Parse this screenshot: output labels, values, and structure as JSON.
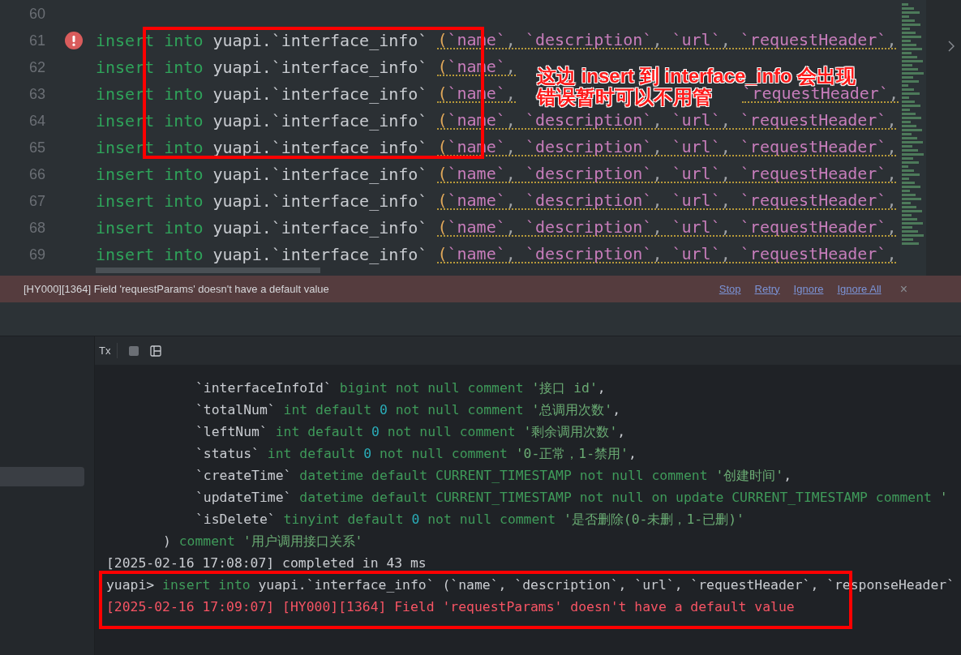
{
  "editor": {
    "lines": [
      {
        "number": "60",
        "error": false
      },
      {
        "number": "61",
        "error": true,
        "warning": true,
        "tokens": [
          {
            "kind": "keyword",
            "text": "insert into "
          },
          {
            "kind": "plain",
            "text": "yuapi.`interface_info` "
          },
          {
            "kind": "paren",
            "text": "("
          },
          {
            "kind": "column",
            "text": "`name`"
          },
          {
            "kind": "punct",
            "text": ", "
          },
          {
            "kind": "column",
            "text": "`description`"
          },
          {
            "kind": "punct",
            "text": ", "
          },
          {
            "kind": "column",
            "text": "`url`"
          },
          {
            "kind": "punct",
            "text": ", "
          },
          {
            "kind": "column",
            "text": "`requestHeader`"
          },
          {
            "kind": "punct",
            "text": ","
          }
        ]
      },
      {
        "number": "62",
        "error": false,
        "warning": true,
        "tokens": [
          {
            "kind": "keyword",
            "text": "insert into "
          },
          {
            "kind": "plain",
            "text": "yuapi.`interface_info` "
          },
          {
            "kind": "paren",
            "text": "("
          },
          {
            "kind": "column",
            "text": "`name`"
          },
          {
            "kind": "punct",
            "text": ","
          }
        ]
      },
      {
        "number": "63",
        "error": false,
        "warning": true,
        "tokens": [
          {
            "kind": "keyword",
            "text": "insert into "
          },
          {
            "kind": "plain",
            "text": "yuapi.`interface_info` "
          },
          {
            "kind": "paren",
            "text": "("
          },
          {
            "kind": "column",
            "text": "`name`"
          },
          {
            "kind": "punct",
            "text": ","
          }
        ],
        "tail_tokens": [
          {
            "kind": "column",
            "text": "`requestHeader`"
          },
          {
            "kind": "punct",
            "text": ","
          }
        ]
      },
      {
        "number": "64",
        "error": false,
        "warning": true,
        "tokens": [
          {
            "kind": "keyword",
            "text": "insert into "
          },
          {
            "kind": "plain",
            "text": "yuapi.`interface_info` "
          },
          {
            "kind": "paren",
            "text": "("
          },
          {
            "kind": "column",
            "text": "`name`"
          },
          {
            "kind": "punct",
            "text": ", "
          },
          {
            "kind": "column",
            "text": "`description`"
          },
          {
            "kind": "punct",
            "text": ", "
          },
          {
            "kind": "column",
            "text": "`url`"
          },
          {
            "kind": "punct",
            "text": ", "
          },
          {
            "kind": "column",
            "text": "`requestHeader`"
          },
          {
            "kind": "punct",
            "text": ","
          }
        ]
      },
      {
        "number": "65",
        "error": false,
        "warning": true,
        "tokens": [
          {
            "kind": "keyword",
            "text": "insert into "
          },
          {
            "kind": "plain",
            "text": "yuapi.`interface_info` "
          },
          {
            "kind": "paren",
            "text": "("
          },
          {
            "kind": "column",
            "text": "`name`"
          },
          {
            "kind": "punct",
            "text": ", "
          },
          {
            "kind": "column",
            "text": "`description`"
          },
          {
            "kind": "punct",
            "text": ", "
          },
          {
            "kind": "column",
            "text": "`url`"
          },
          {
            "kind": "punct",
            "text": ", "
          },
          {
            "kind": "column",
            "text": "`requestHeader`"
          },
          {
            "kind": "punct",
            "text": ","
          }
        ]
      },
      {
        "number": "66",
        "error": false,
        "warning": true,
        "tokens": [
          {
            "kind": "keyword",
            "text": "insert into "
          },
          {
            "kind": "plain",
            "text": "yuapi.`interface_info` "
          },
          {
            "kind": "paren",
            "text": "("
          },
          {
            "kind": "column",
            "text": "`name`"
          },
          {
            "kind": "punct",
            "text": ", "
          },
          {
            "kind": "column",
            "text": "`description`"
          },
          {
            "kind": "punct",
            "text": ", "
          },
          {
            "kind": "column",
            "text": "`url`"
          },
          {
            "kind": "punct",
            "text": ", "
          },
          {
            "kind": "column",
            "text": "`requestHeader`"
          },
          {
            "kind": "punct",
            "text": ","
          }
        ]
      },
      {
        "number": "67",
        "error": false,
        "warning": true,
        "tokens": [
          {
            "kind": "keyword",
            "text": "insert into "
          },
          {
            "kind": "plain",
            "text": "yuapi.`interface_info` "
          },
          {
            "kind": "paren",
            "text": "("
          },
          {
            "kind": "column",
            "text": "`name`"
          },
          {
            "kind": "punct",
            "text": ", "
          },
          {
            "kind": "column",
            "text": "`description`"
          },
          {
            "kind": "punct",
            "text": ", "
          },
          {
            "kind": "column",
            "text": "`url`"
          },
          {
            "kind": "punct",
            "text": ", "
          },
          {
            "kind": "column",
            "text": "`requestHeader`"
          },
          {
            "kind": "punct",
            "text": ","
          }
        ]
      },
      {
        "number": "68",
        "error": false,
        "warning": true,
        "tokens": [
          {
            "kind": "keyword",
            "text": "insert into "
          },
          {
            "kind": "plain",
            "text": "yuapi.`interface_info` "
          },
          {
            "kind": "paren",
            "text": "("
          },
          {
            "kind": "column",
            "text": "`name`"
          },
          {
            "kind": "punct",
            "text": ", "
          },
          {
            "kind": "column",
            "text": "`description`"
          },
          {
            "kind": "punct",
            "text": ", "
          },
          {
            "kind": "column",
            "text": "`url`"
          },
          {
            "kind": "punct",
            "text": ", "
          },
          {
            "kind": "column",
            "text": "`requestHeader`"
          },
          {
            "kind": "punct",
            "text": ","
          }
        ]
      },
      {
        "number": "69",
        "error": false,
        "warning": true,
        "tokens": [
          {
            "kind": "keyword",
            "text": "insert into "
          },
          {
            "kind": "plain",
            "text": "yuapi.`interface_info` "
          },
          {
            "kind": "paren",
            "text": "("
          },
          {
            "kind": "column",
            "text": "`name`"
          },
          {
            "kind": "punct",
            "text": ", "
          },
          {
            "kind": "column",
            "text": "`description`"
          },
          {
            "kind": "punct",
            "text": ", "
          },
          {
            "kind": "column",
            "text": "`url`"
          },
          {
            "kind": "punct",
            "text": ", "
          },
          {
            "kind": "column",
            "text": "`requestHeader`"
          },
          {
            "kind": "punct",
            "text": ","
          }
        ]
      }
    ],
    "error_bar": {
      "message": "[HY000][1364] Field 'requestParams' doesn't have a default value",
      "actions": [
        "Stop",
        "Retry",
        "Ignore",
        "Ignore All"
      ],
      "close": "×"
    },
    "annotation": [
      "这边 insert 到 interface_info 会出现",
      "错误暂时可以不用管"
    ]
  },
  "console": {
    "toolbar": {
      "tx": "Tx"
    },
    "sidebar": {
      "items": [
        {
          "selected": true
        }
      ]
    },
    "lines": [
      {
        "kind": "column",
        "tokens": [
          {
            "kind": "field",
            "text": "`interfaceInfoId` "
          },
          {
            "kind": "keyword",
            "text": "bigint not null comment "
          },
          {
            "kind": "string",
            "text": "'接口 id'"
          },
          {
            "kind": "plain",
            "text": ","
          }
        ]
      },
      {
        "kind": "column",
        "tokens": [
          {
            "kind": "field",
            "text": "`totalNum` "
          },
          {
            "kind": "keyword",
            "text": "int default "
          },
          {
            "kind": "number",
            "text": "0"
          },
          {
            "kind": "keyword",
            "text": " not null comment "
          },
          {
            "kind": "string",
            "text": "'总调用次数'"
          },
          {
            "kind": "plain",
            "text": ","
          }
        ]
      },
      {
        "kind": "column",
        "tokens": [
          {
            "kind": "field",
            "text": "`leftNum` "
          },
          {
            "kind": "keyword",
            "text": "int default "
          },
          {
            "kind": "number",
            "text": "0"
          },
          {
            "kind": "keyword",
            "text": " not null comment "
          },
          {
            "kind": "string",
            "text": "'剩余调用次数'"
          },
          {
            "kind": "plain",
            "text": ","
          }
        ]
      },
      {
        "kind": "column",
        "tokens": [
          {
            "kind": "field",
            "text": "`status` "
          },
          {
            "kind": "keyword",
            "text": "int default "
          },
          {
            "kind": "number",
            "text": "0"
          },
          {
            "kind": "keyword",
            "text": " not null comment "
          },
          {
            "kind": "string",
            "text": "'0-正常，1-禁用'"
          },
          {
            "kind": "plain",
            "text": ","
          }
        ]
      },
      {
        "kind": "column",
        "tokens": [
          {
            "kind": "field",
            "text": "`createTime` "
          },
          {
            "kind": "keyword",
            "text": "datetime default CURRENT_TIMESTAMP not null comment "
          },
          {
            "kind": "string",
            "text": "'创建时间'"
          },
          {
            "kind": "plain",
            "text": ","
          }
        ]
      },
      {
        "kind": "column",
        "tokens": [
          {
            "kind": "field",
            "text": "`updateTime` "
          },
          {
            "kind": "keyword",
            "text": "datetime default CURRENT_TIMESTAMP not null on update CURRENT_TIMESTAMP comment "
          },
          {
            "kind": "string",
            "text": "'"
          }
        ]
      },
      {
        "kind": "column",
        "tokens": [
          {
            "kind": "field",
            "text": "`isDelete` "
          },
          {
            "kind": "keyword",
            "text": "tinyint default "
          },
          {
            "kind": "number",
            "text": "0"
          },
          {
            "kind": "keyword",
            "text": " not null comment "
          },
          {
            "kind": "string",
            "text": "'是否删除(0-未删，1-已删)'"
          }
        ]
      },
      {
        "kind": "close",
        "tokens": [
          {
            "kind": "plain",
            "text": ") "
          },
          {
            "kind": "keyword",
            "text": "comment "
          },
          {
            "kind": "string",
            "text": "'用户调用接口关系'"
          }
        ]
      },
      {
        "kind": "log",
        "tokens": [
          {
            "kind": "plain",
            "text": "[2025-02-16 17:08:07] completed in 43 ms"
          }
        ]
      },
      {
        "kind": "log",
        "tokens": [
          {
            "kind": "plain",
            "text": "yuapi> "
          },
          {
            "kind": "keyword",
            "text": "insert into "
          },
          {
            "kind": "plain",
            "text": "yuapi.`interface_info` (`name`, `description`, `url`, `requestHeader`, `responseHeader`"
          }
        ]
      },
      {
        "kind": "log",
        "tokens": [
          {
            "kind": "error",
            "text": "[2025-02-16 17:09:07] [HY000][1364] Field 'requestParams' doesn't have a default value"
          }
        ]
      }
    ]
  }
}
